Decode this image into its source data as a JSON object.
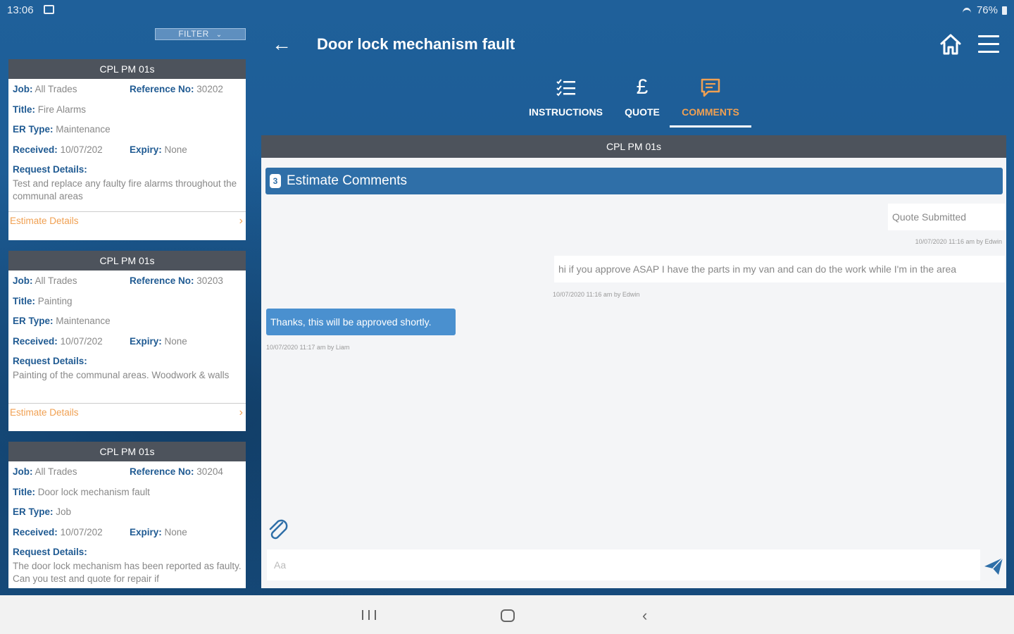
{
  "status": {
    "time": "13:06",
    "battery": "76%"
  },
  "filter": {
    "label": "FILTER"
  },
  "cards": [
    {
      "header": "CPL PM 01s",
      "job_label": "Job:",
      "job": "All Trades",
      "ref_label": "Reference No:",
      "ref": "30202",
      "title_label": "Title:",
      "title": "Fire Alarms",
      "er_label": "ER Type:",
      "er": "Maintenance",
      "received_label": "Received:",
      "received": "10/07/202",
      "expiry_label": "Expiry:",
      "expiry": "None",
      "request_label": "Request Details:",
      "request": "Test and replace any faulty fire alarms throughout the communal areas",
      "estimate": "Estimate Details"
    },
    {
      "header": "CPL PM 01s",
      "job_label": "Job:",
      "job": "All Trades",
      "ref_label": "Reference No:",
      "ref": "30203",
      "title_label": "Title:",
      "title": "Painting",
      "er_label": "ER Type:",
      "er": "Maintenance",
      "received_label": "Received:",
      "received": "10/07/202",
      "expiry_label": "Expiry:",
      "expiry": "None",
      "request_label": "Request Details:",
      "request": "Painting of the communal areas. Woodwork & walls",
      "estimate": "Estimate Details"
    },
    {
      "header": "CPL PM 01s",
      "job_label": "Job:",
      "job": "All Trades",
      "ref_label": "Reference No:",
      "ref": "30204",
      "title_label": "Title:",
      "title": "Door lock mechanism fault",
      "er_label": "ER Type:",
      "er": "Job",
      "received_label": "Received:",
      "received": "10/07/202",
      "expiry_label": "Expiry:",
      "expiry": "None",
      "request_label": "Request Details:",
      "request": "The door lock mechanism has been reported as faulty. Can you test and quote for repair if"
    }
  ],
  "header": {
    "title": "Door lock mechanism fault"
  },
  "tabs": [
    {
      "label": "INSTRUCTIONS",
      "icon": "checklist-icon"
    },
    {
      "label": "QUOTE",
      "icon": "pound-icon"
    },
    {
      "label": "COMMENTS",
      "icon": "comment-icon",
      "active": true
    }
  ],
  "panel": {
    "header": "CPL PM 01s",
    "section_number": "3",
    "section_title": "Estimate Comments"
  },
  "messages": [
    {
      "text": "Quote Submitted",
      "meta": "10/07/2020 11:16 am  by  Edwin"
    },
    {
      "text": "hi if you approve ASAP I have the parts in my van and can do the work while I'm in the area",
      "meta": "10/07/2020 11:16 am  by  Edwin"
    },
    {
      "text": "Thanks, this will be approved shortly.",
      "meta": "10/07/2020 11:17 am  by  Liam"
    }
  ],
  "composer": {
    "placeholder": "Aa"
  },
  "colors": {
    "brand_blue": "#1b5c94",
    "accent_orange": "#f0a052",
    "card_header": "#4d535c",
    "own_bubble": "#4a90cf"
  }
}
